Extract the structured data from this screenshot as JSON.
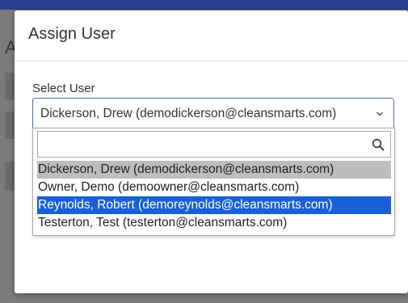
{
  "background": {
    "title_fragment": "A"
  },
  "modal": {
    "title": "Assign User",
    "field_label": "Select User",
    "selected_value": "Dickerson, Drew (demodickerson@cleansmarts.com)",
    "search": {
      "value": "",
      "placeholder": ""
    },
    "options": [
      {
        "label": "Dickerson, Drew (demodickerson@cleansmarts.com)",
        "state": "hover"
      },
      {
        "label": "Owner, Demo (demoowner@cleansmarts.com)",
        "state": "normal"
      },
      {
        "label": "Reynolds, Robert (demoreynolds@cleansmarts.com)",
        "state": "selected"
      },
      {
        "label": "Testerton, Test (testerton@cleansmarts.com)",
        "state": "normal"
      }
    ]
  },
  "icons": {
    "dropdown": "chevron-down-icon",
    "search": "search-icon"
  },
  "colors": {
    "topbar": "#2a3f8c",
    "highlight": "#1a5fd6",
    "hover": "#bdbdbd",
    "focus_border": "#4a6fb5"
  }
}
